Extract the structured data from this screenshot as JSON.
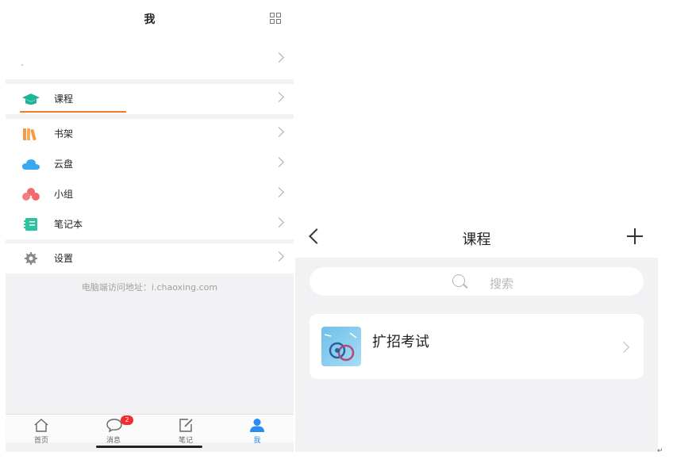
{
  "me_screen": {
    "title": "我",
    "qr_icon": "qr-code-icon",
    "menu": [
      {
        "key": "course",
        "label": "课程",
        "icon": "graduation-cap-icon",
        "color": "#1fb39a"
      },
      {
        "key": "bookshelf",
        "label": "书架",
        "icon": "bookshelf-icon",
        "color": "#f59a45"
      },
      {
        "key": "cloud",
        "label": "云盘",
        "icon": "cloud-icon",
        "color": "#39a8f0"
      },
      {
        "key": "group",
        "label": "小组",
        "icon": "group-icon",
        "color": "#f26b6b"
      },
      {
        "key": "notebook",
        "label": "笔记本",
        "icon": "notebook-icon",
        "color": "#2fc29e"
      },
      {
        "key": "settings",
        "label": "设置",
        "icon": "gear-icon",
        "color": "#8a8a8a"
      }
    ],
    "footer_url": "电脑端访问地址：i.chaoxing.com",
    "tabs": [
      {
        "label": "首页",
        "icon": "home-icon"
      },
      {
        "label": "消息",
        "icon": "message-icon",
        "badge": "2"
      },
      {
        "label": "笔记",
        "icon": "note-edit-icon"
      },
      {
        "label": "我",
        "icon": "user-icon",
        "active": true
      }
    ],
    "accent_color": "#2a8bf0",
    "underline_color": "#f07a2a"
  },
  "course_screen": {
    "title": "课程",
    "search_placeholder": "搜索",
    "courses": [
      {
        "name": "扩招考试"
      }
    ]
  },
  "corner_mark": "↵"
}
